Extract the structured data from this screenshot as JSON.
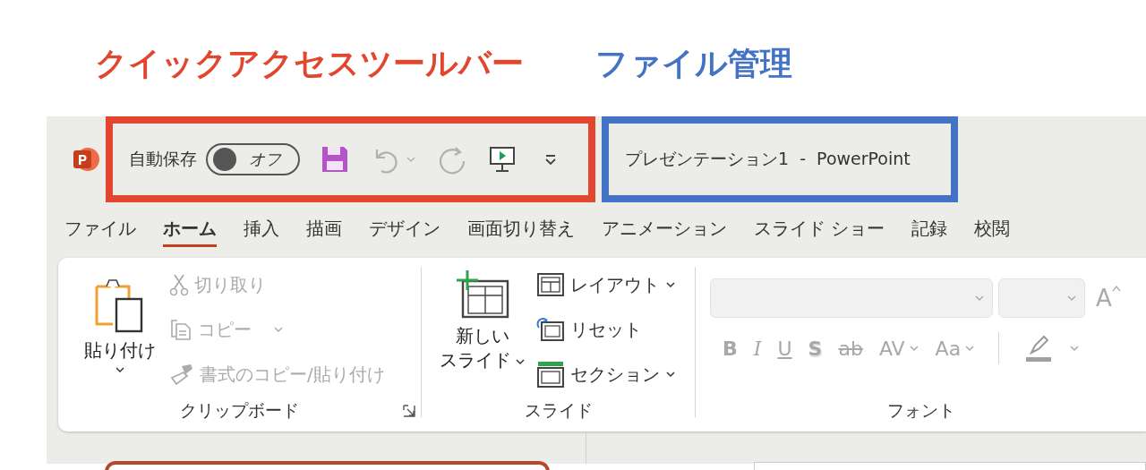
{
  "annotations": [
    {
      "label": "クイックアクセスツールバー",
      "color": "#e2462f"
    },
    {
      "label": "ファイル管理",
      "color": "#4472c4"
    }
  ],
  "title_bar": {
    "autosave": {
      "label": "自動保存",
      "on": false,
      "state_label": "オフ"
    },
    "quick_access": [
      {
        "kind": "save",
        "disabled": false
      },
      {
        "kind": "undo",
        "disabled": true
      },
      {
        "kind": "redo",
        "disabled": true
      },
      {
        "kind": "present",
        "disabled": false
      },
      {
        "kind": "customize",
        "disabled": false
      }
    ],
    "document_title": "プレゼンテーション1  -  PowerPoint"
  },
  "tabs": [
    {
      "label": "ファイル",
      "selected": false
    },
    {
      "label": "ホーム",
      "selected": true
    },
    {
      "label": "挿入",
      "selected": false
    },
    {
      "label": "描画",
      "selected": false
    },
    {
      "label": "デザイン",
      "selected": false
    },
    {
      "label": "画面切り替え",
      "selected": false
    },
    {
      "label": "アニメーション",
      "selected": false
    },
    {
      "label": "スライド ショー",
      "selected": false
    },
    {
      "label": "記録",
      "selected": false
    },
    {
      "label": "校閲",
      "selected": false
    }
  ],
  "ribbon": {
    "clipboard": {
      "paste": "貼り付け",
      "items": [
        {
          "kind": "cut",
          "label": "切り取り",
          "disabled": true,
          "dropdown": false
        },
        {
          "kind": "copy",
          "label": "コピー",
          "disabled": true,
          "dropdown": true
        },
        {
          "kind": "format_painter",
          "label": "書式のコピー/貼り付け",
          "disabled": true,
          "dropdown": false
        }
      ],
      "group_label": "クリップボード"
    },
    "slides": {
      "new_slide": [
        "新しい",
        "スライド"
      ],
      "items": [
        {
          "kind": "layout",
          "label": "レイアウト",
          "dropdown": true
        },
        {
          "kind": "reset",
          "label": "リセット",
          "dropdown": false
        },
        {
          "kind": "section",
          "label": "セクション",
          "dropdown": true
        }
      ],
      "group_label": "スライド"
    },
    "font": {
      "grow_button": "A",
      "buttons": [
        {
          "kind": "bold",
          "label": "B",
          "disabled": true,
          "dropdown": false
        },
        {
          "kind": "italic",
          "label": "I",
          "disabled": true,
          "dropdown": false
        },
        {
          "kind": "underline",
          "label": "U",
          "disabled": true,
          "dropdown": false
        },
        {
          "kind": "shadow",
          "label": "S",
          "disabled": true,
          "dropdown": false
        },
        {
          "kind": "strike",
          "label": "ab",
          "disabled": true,
          "dropdown": false
        },
        {
          "kind": "spacing",
          "label": "AV",
          "disabled": true,
          "dropdown": true
        },
        {
          "kind": "case",
          "label": "Aa",
          "disabled": true,
          "dropdown": true
        }
      ],
      "group_label": "フォント"
    }
  }
}
